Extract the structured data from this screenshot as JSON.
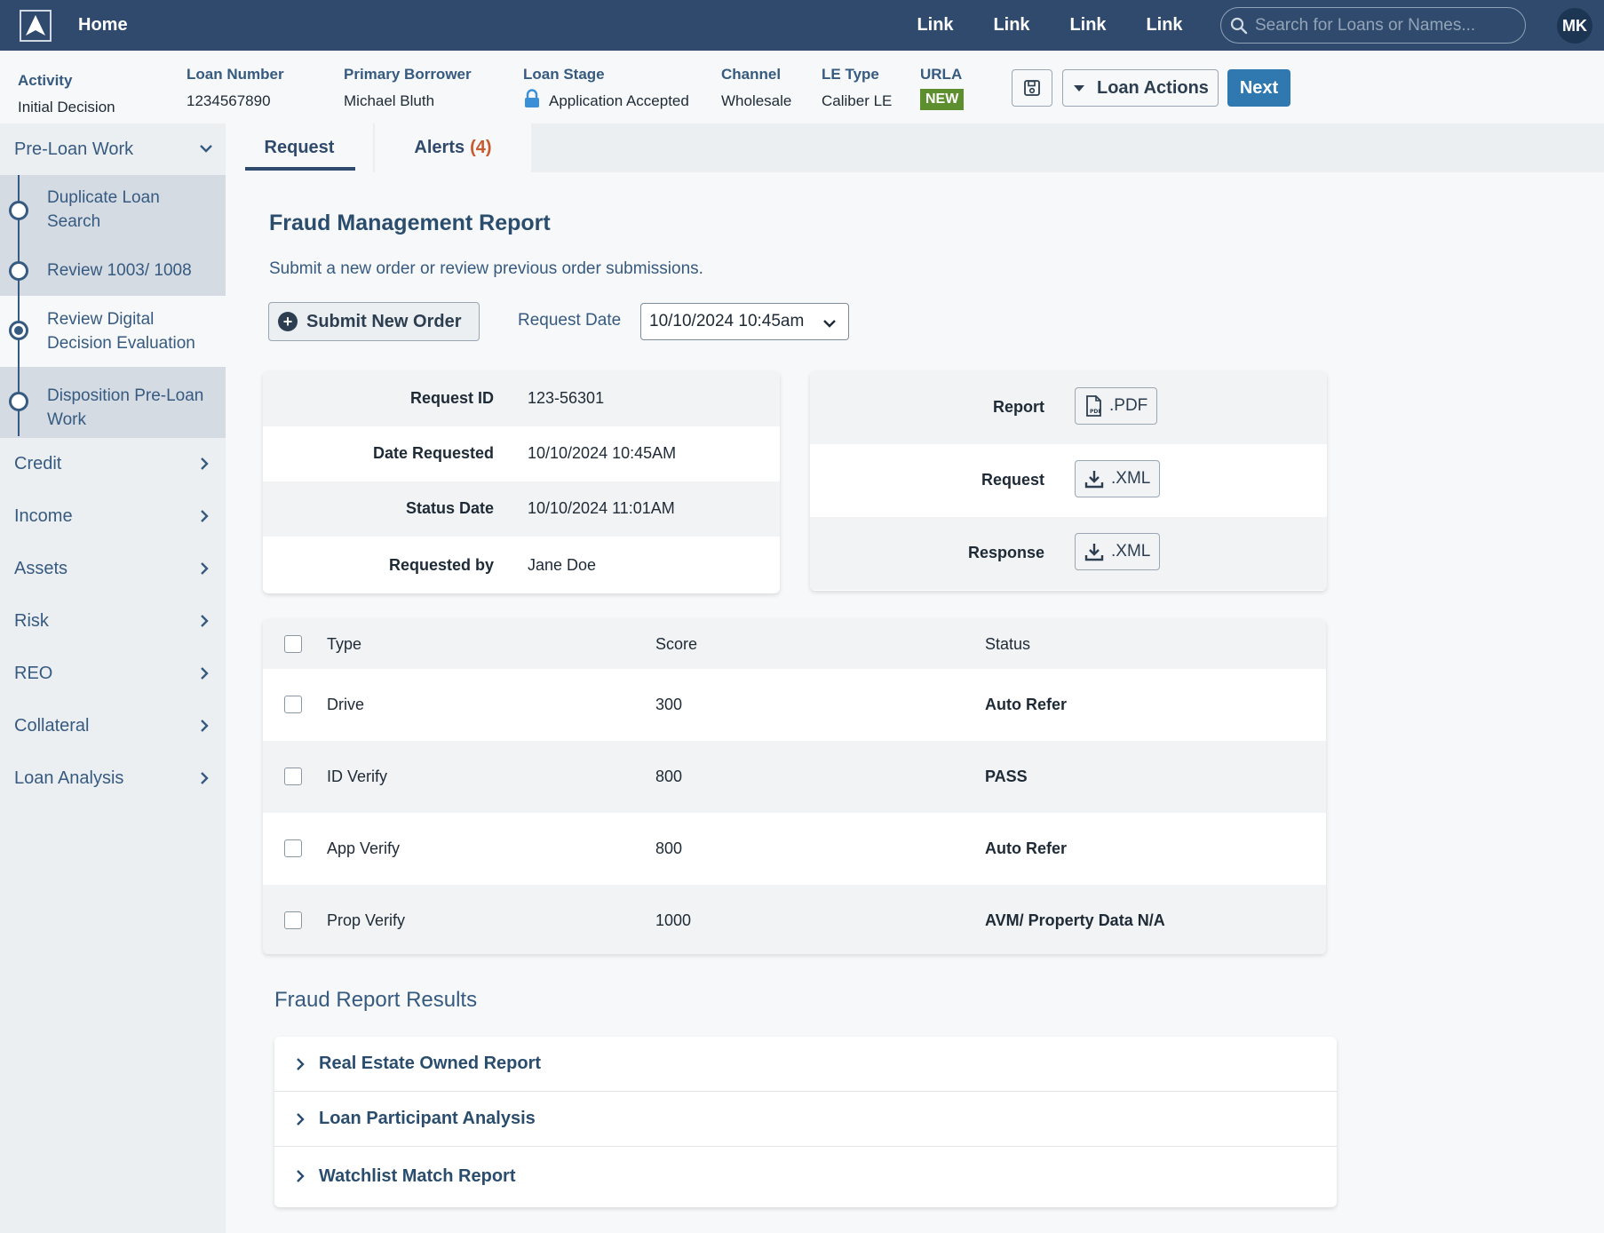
{
  "nav": {
    "home": "Home",
    "links": [
      "Link",
      "Link",
      "Link",
      "Link"
    ],
    "search_placeholder": "Search for Loans or Names...",
    "avatar_initials": "MK"
  },
  "info": {
    "activity_label": "Activity",
    "activity_value": "Initial Decision",
    "loan_number_label": "Loan Number",
    "loan_number_value": "1234567890",
    "primary_borrower_label": "Primary Borrower",
    "primary_borrower_value": "Michael Bluth",
    "loan_stage_label": "Loan Stage",
    "loan_stage_value": "Application Accepted",
    "channel_label": "Channel",
    "channel_value": "Wholesale",
    "le_type_label": "LE Type",
    "le_type_value": "Caliber LE",
    "urla_label": "URLA",
    "urla_badge": "NEW",
    "loan_actions_label": "Loan Actions",
    "next_label": "Next"
  },
  "sidebar": {
    "section": "Pre-Loan Work",
    "sub_items": [
      {
        "line1": "Duplicate Loan",
        "line2": "Search"
      },
      {
        "line1": "Review 1003/ 1008",
        "line2": ""
      },
      {
        "line1": "Review Digital",
        "line2": "Decision Evaluation"
      },
      {
        "line1": "Disposition Pre-Loan",
        "line2": "Work"
      }
    ],
    "items": [
      "Credit",
      "Income",
      "Assets",
      "Risk",
      "REO",
      "Collateral",
      "Loan Analysis"
    ]
  },
  "tabs": {
    "request": "Request",
    "alerts": "Alerts",
    "alerts_count": "(4)"
  },
  "main": {
    "title": "Fraud Management Report",
    "subtitle": "Submit a new order or review previous order submissions.",
    "submit_label": "Submit New Order",
    "request_date_label": "Request Date",
    "request_date_value": "10/10/2024 10:45am"
  },
  "details": [
    {
      "label": "Request ID",
      "value": "123-56301"
    },
    {
      "label": "Date Requested",
      "value": "10/10/2024 10:45AM"
    },
    {
      "label": "Status Date",
      "value": "10/10/2024 11:01AM"
    },
    {
      "label": "Requested by",
      "value": "Jane Doe"
    }
  ],
  "downloads": [
    {
      "label": "Report",
      "button": ".PDF"
    },
    {
      "label": "Request",
      "button": ".XML"
    },
    {
      "label": "Response",
      "button": ".XML"
    }
  ],
  "table": {
    "headers": {
      "type": "Type",
      "score": "Score",
      "status": "Status"
    },
    "rows": [
      {
        "type": "Drive",
        "score": "300",
        "status": "Auto Refer"
      },
      {
        "type": "ID Verify",
        "score": "800",
        "status": "PASS"
      },
      {
        "type": "App Verify",
        "score": "800",
        "status": "Auto Refer"
      },
      {
        "type": "Prop Verify",
        "score": "1000",
        "status": "AVM/ Property Data N/A"
      }
    ]
  },
  "results": {
    "title": "Fraud Report Results",
    "items": [
      "Real Estate Owned Report",
      "Loan Participant Analysis",
      "Watchlist Match Report"
    ]
  },
  "colors": {
    "nav_bg": "#2f4a6c",
    "accent": "#2f78b0",
    "badge_new": "#5e8f2e",
    "alert_count": "#c75a2e"
  }
}
